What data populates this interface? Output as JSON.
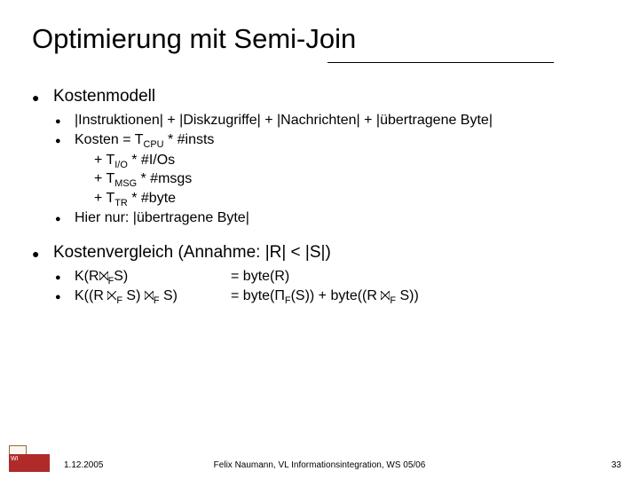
{
  "title": "Optimierung mit Semi-Join",
  "sections": {
    "kostenmodell": {
      "label": "Kostenmodell",
      "item1": "|Instruktionen| + |Diskzugriffe| + |Nachrichten| + |übertragene Byte|",
      "item2": {
        "head": "Kosten = T",
        "sub0": "CPU",
        "tail0": " * #insts",
        "l1a": "+ T",
        "sub1": "I/O",
        "l1b": " * #I/Os",
        "l2a": "+ T",
        "sub2": "MSG",
        "l2b": " * #msgs",
        "l3a": "+ T",
        "sub3": "TR",
        "l3b": " * #byte"
      },
      "item3": "Hier nur: |übertragene Byte|"
    },
    "vergleich": {
      "label": "Kostenvergleich (Annahme: |R| < |S|)",
      "row1": {
        "left_a": "K(R",
        "left_sub": "F",
        "left_b": "S)",
        "right": "= byte(R)"
      },
      "row2": {
        "left_a": "K((R ",
        "left_sub1": "F",
        "left_b": " S) ",
        "left_sub2": "F",
        "left_c": " S)",
        "right_a": "= byte(Π",
        "right_sub1": "F",
        "right_b": "(S)) + byte((R ",
        "right_sub2": "F",
        "right_c": " S))"
      }
    }
  },
  "footer": {
    "date": "1.12.2005",
    "center": "Felix Naumann, VL Informationsintegration, WS 05/06",
    "page": "33"
  },
  "logo_text": "WI"
}
